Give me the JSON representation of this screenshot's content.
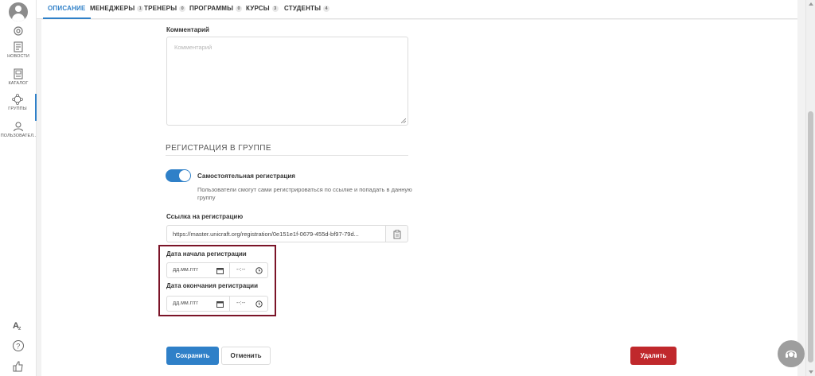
{
  "sidebar": {
    "items": [
      {
        "label": "новости",
        "icon": "news-icon"
      },
      {
        "label": "каталог",
        "icon": "catalog-icon"
      },
      {
        "label": "группы",
        "icon": "groups-icon"
      },
      {
        "label": "пользовател..",
        "icon": "users-icon"
      }
    ],
    "active_index": 2
  },
  "tabs": [
    {
      "label": "ОПИСАНИЕ",
      "count": null
    },
    {
      "label": "МЕНЕДЖЕРЫ",
      "count": "1"
    },
    {
      "label": "ТРЕНЕРЫ",
      "count": "0"
    },
    {
      "label": "ПРОГРАММЫ",
      "count": "0"
    },
    {
      "label": "КУРСЫ",
      "count": "3"
    },
    {
      "label": "СТУДЕНТЫ",
      "count": "4"
    }
  ],
  "active_tab": 0,
  "comment": {
    "label": "Комментарий",
    "placeholder": "Комментарий"
  },
  "registration": {
    "section_title": "РЕГИСТРАЦИЯ В ГРУППЕ",
    "self_registration_label": "Самостоятельная регистрация",
    "self_registration_enabled": true,
    "self_registration_desc": "Пользователи смогут сами регистрироваться по ссылке и попадать в данную группу",
    "link_label": "Ссылка на регистрацию",
    "link_value": "https://master.unicraft.org/registration/0e151e1f-0679-455d-bf97-79d...",
    "start_label": "Дата начала регистрации",
    "end_label": "Дата окончания регистрации",
    "date_placeholder": "дд.мм.гггг",
    "time_placeholder": "--:--"
  },
  "actions": {
    "save": "Сохранить",
    "cancel": "Отменить",
    "delete": "Удалить"
  },
  "colors": {
    "accent": "#2f80c8",
    "danger": "#c0282c",
    "highlight": "#7b1428"
  }
}
